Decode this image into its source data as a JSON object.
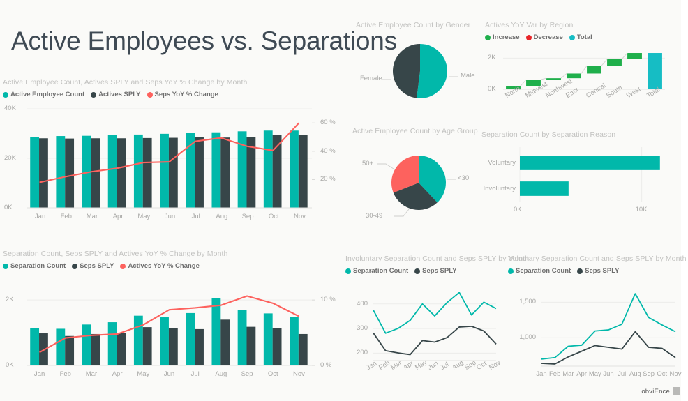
{
  "report": {
    "title": "Active Employees vs. Separations",
    "footer_brand": "obviEnce",
    "colors": {
      "teal": "#01B8AA",
      "dark": "#374649",
      "red": "#FD625E",
      "green": "#1FAF4B",
      "decrease_red": "#E8262A",
      "total_teal": "#16BDC4",
      "title_text": "#3F4A54",
      "muted_text": "#C2C2C0",
      "axis_text": "#A8A8A6",
      "grid": "#EDEDEB",
      "background": "#FAFAF8"
    }
  },
  "chart_data": [
    {
      "id": "actives_by_month",
      "type": "bar",
      "title": "Active Employee Count, Actives SPLY and Seps YoY % Change by Month",
      "legend": [
        {
          "label": "Active Employee Count",
          "color": "#01B8AA",
          "kind": "bar"
        },
        {
          "label": "Actives SPLY",
          "color": "#374649",
          "kind": "bar"
        },
        {
          "label": "Seps YoY % Change",
          "color": "#FD625E",
          "kind": "line"
        }
      ],
      "legend_position": "top-left",
      "categories": [
        "Jan",
        "Feb",
        "Mar",
        "Apr",
        "May",
        "Jun",
        "Jul",
        "Aug",
        "Sep",
        "Oct",
        "Nov"
      ],
      "series": [
        {
          "name": "Active Employee Count",
          "color": "#01B8AA",
          "type": "bar",
          "values": [
            28700,
            29000,
            29100,
            29300,
            29600,
            29900,
            30200,
            30500,
            30900,
            31200,
            31200
          ]
        },
        {
          "name": "Actives SPLY",
          "color": "#374649",
          "type": "bar",
          "values": [
            28100,
            28000,
            28100,
            28100,
            28200,
            28300,
            28600,
            28400,
            28700,
            29300,
            29500
          ]
        },
        {
          "name": "Seps YoY % Change",
          "color": "#FD625E",
          "type": "line",
          "axis": "right",
          "values": [
            18.0,
            22.0,
            25.5,
            28.0,
            32.0,
            32.5,
            47.0,
            49.5,
            43.5,
            40.5,
            60.0
          ]
        }
      ],
      "ylabel": "",
      "xlabel": "",
      "ylim": [
        0,
        40000
      ],
      "yticks": [
        "0K",
        "20K",
        "40K"
      ],
      "y2lim": [
        0,
        70
      ],
      "y2ticks": [
        "20 %",
        "40 %",
        "60 %"
      ],
      "grid": true
    },
    {
      "id": "gender_pie",
      "type": "pie",
      "title": "Active Employee Count by Gender",
      "labels": [
        "Male",
        "Female"
      ],
      "values": [
        52,
        48
      ],
      "colors": [
        "#01B8AA",
        "#374649"
      ],
      "grid": false,
      "legend_position": "callout-labels"
    },
    {
      "id": "actives_yoy_region",
      "type": "bar",
      "subtype": "waterfall",
      "title": "Actives YoY Var by Region",
      "legend": [
        {
          "label": "Increase",
          "color": "#1FAF4B"
        },
        {
          "label": "Decrease",
          "color": "#E8262A"
        },
        {
          "label": "Total",
          "color": "#16BDC4"
        }
      ],
      "legend_position": "top-left",
      "categories": [
        "North",
        "Midwest",
        "Northwest",
        "East",
        "Central",
        "South",
        "West",
        "Total"
      ],
      "values": [
        210,
        410,
        90,
        300,
        500,
        420,
        400,
        2330
      ],
      "kinds": [
        "increase",
        "increase",
        "increase",
        "increase",
        "increase",
        "increase",
        "increase",
        "total"
      ],
      "ylim": [
        0,
        2600
      ],
      "yticks": [
        "0K",
        "2K"
      ],
      "ylabel": "",
      "xlabel": "",
      "grid": true
    },
    {
      "id": "age_group_pie",
      "type": "pie",
      "title": "Active Employee Count by Age Group",
      "labels": [
        "<30",
        "30-49",
        "50+"
      ],
      "values": [
        38,
        31,
        31
      ],
      "colors": [
        "#01B8AA",
        "#374649",
        "#FD625E"
      ],
      "grid": false,
      "legend_position": "callout-labels"
    },
    {
      "id": "separation_reason",
      "type": "bar",
      "subtype": "horizontal",
      "title": "Separation Count by Separation Reason",
      "categories": [
        "Voluntary",
        "Involuntary"
      ],
      "values": [
        11500,
        4000
      ],
      "colors": [
        "#01B8AA",
        "#01B8AA"
      ],
      "xlim": [
        0,
        13000
      ],
      "xticks": [
        "0K",
        "10K"
      ],
      "ylabel": "",
      "xlabel": "",
      "grid": true
    },
    {
      "id": "separations_by_month",
      "type": "bar",
      "title": "Separation Count, Seps SPLY and Actives YoY % Change by Month",
      "legend": [
        {
          "label": "Separation Count",
          "color": "#01B8AA",
          "kind": "bar"
        },
        {
          "label": "Seps SPLY",
          "color": "#374649",
          "kind": "bar"
        },
        {
          "label": "Actives YoY % Change",
          "color": "#FD625E",
          "kind": "line"
        }
      ],
      "legend_position": "top-left",
      "categories": [
        "Jan",
        "Feb",
        "Mar",
        "Apr",
        "May",
        "Jun",
        "Jul",
        "Aug",
        "Sep",
        "Oct",
        "Nov"
      ],
      "series": [
        {
          "name": "Separation Count",
          "color": "#01B8AA",
          "type": "bar",
          "values": [
            1150,
            1120,
            1250,
            1320,
            1520,
            1470,
            1600,
            2050,
            1700,
            1590,
            1480
          ]
        },
        {
          "name": "Seps SPLY",
          "color": "#374649",
          "type": "bar",
          "values": [
            980,
            900,
            960,
            1000,
            1170,
            1140,
            1110,
            1400,
            1180,
            1140,
            960
          ]
        },
        {
          "name": "Actives YoY % Change",
          "color": "#FD625E",
          "type": "line",
          "axis": "right",
          "values": [
            2.0,
            4.2,
            4.6,
            4.8,
            6.2,
            8.5,
            8.8,
            9.2,
            10.6,
            9.5,
            7.5
          ]
        }
      ],
      "ylim": [
        0,
        2600
      ],
      "yticks": [
        "0K",
        "2K"
      ],
      "y2lim": [
        0,
        13
      ],
      "y2ticks": [
        "0 %",
        "10 %"
      ],
      "grid": true
    },
    {
      "id": "involuntary_by_month",
      "type": "line",
      "title": "Involuntary Separation Count and Seps SPLY by Month",
      "legend": [
        {
          "label": "Separation Count",
          "color": "#01B8AA"
        },
        {
          "label": "Seps SPLY",
          "color": "#374649"
        }
      ],
      "legend_position": "top-left",
      "categories": [
        "Jan",
        "Feb",
        "Mar",
        "Apr",
        "May",
        "Jun",
        "Jul",
        "Aug",
        "Sep",
        "Oct",
        "Nov"
      ],
      "series": [
        {
          "name": "Separation Count",
          "color": "#01B8AA",
          "values": [
            375,
            281,
            300,
            333,
            400,
            351,
            405,
            446,
            355,
            407,
            381
          ]
        },
        {
          "name": "Seps SPLY",
          "color": "#374649",
          "values": [
            282,
            210,
            201,
            194,
            251,
            245,
            263,
            306,
            309,
            290,
            237
          ]
        }
      ],
      "ylim": [
        170,
        470
      ],
      "yticks": [
        "200",
        "300",
        "400"
      ],
      "ylabel": "",
      "xlabel": "",
      "grid": true
    },
    {
      "id": "voluntary_by_month",
      "type": "line",
      "title": "Voluntary Separation Count and Seps SPLY by Month",
      "legend": [
        {
          "label": "Separation Count",
          "color": "#01B8AA"
        },
        {
          "label": "Seps SPLY",
          "color": "#374649"
        }
      ],
      "legend_position": "top-left",
      "categories": [
        "Jan",
        "Feb",
        "Mar",
        "Apr",
        "May",
        "Jun",
        "Jul",
        "Aug",
        "Sep",
        "Oct",
        "Nov"
      ],
      "series": [
        {
          "name": "Separation Count",
          "color": "#01B8AA",
          "values": [
            700,
            720,
            880,
            895,
            1095,
            1110,
            1190,
            1620,
            1285,
            1180,
            1085
          ]
        },
        {
          "name": "Seps SPLY",
          "color": "#374649",
          "values": [
            640,
            630,
            730,
            810,
            890,
            865,
            840,
            1085,
            865,
            850,
            720
          ]
        }
      ],
      "ylim": [
        600,
        1700
      ],
      "yticks": [
        "1,000",
        "1,500"
      ],
      "ylabel": "",
      "xlabel": "",
      "grid": true
    }
  ]
}
